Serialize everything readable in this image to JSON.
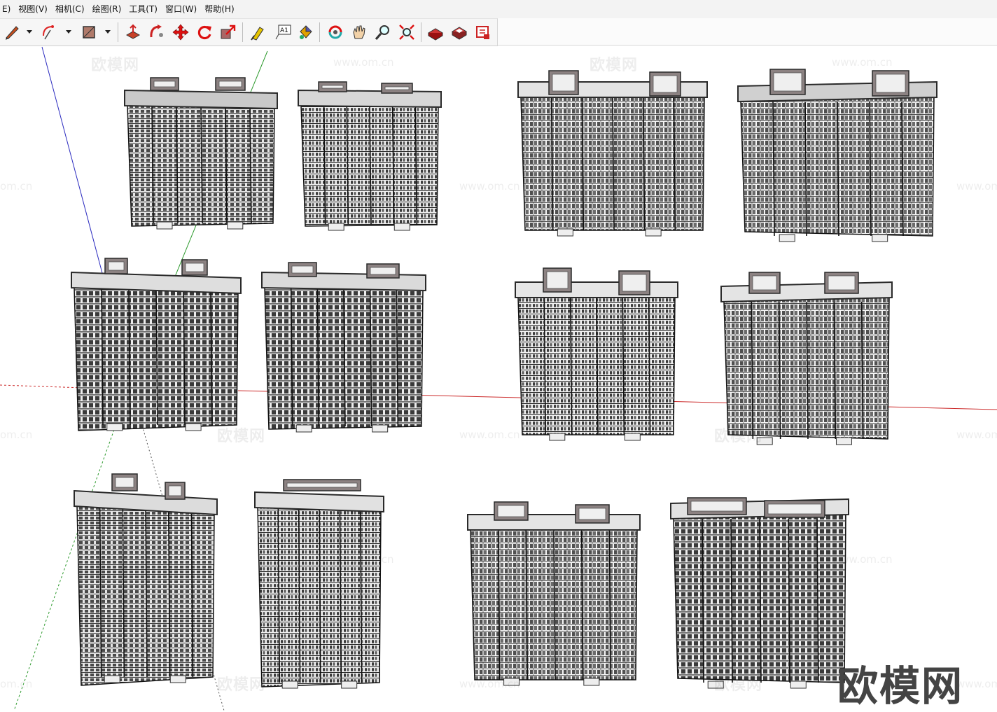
{
  "menu": {
    "items": [
      {
        "name": "menu-edit",
        "label": "E)"
      },
      {
        "name": "menu-view",
        "label": "视图(V)"
      },
      {
        "name": "menu-camera",
        "label": "相机(C)"
      },
      {
        "name": "menu-draw",
        "label": "绘图(R)"
      },
      {
        "name": "menu-tools",
        "label": "工具(T)"
      },
      {
        "name": "menu-window",
        "label": "窗口(W)"
      },
      {
        "name": "menu-help",
        "label": "帮助(H)"
      }
    ]
  },
  "toolbar": {
    "icons": [
      "pencil-icon",
      "arc-icon",
      "rectangle-icon",
      "push-pull-icon",
      "follow-me-icon",
      "move-icon",
      "rotate-icon",
      "scale-icon",
      "tape-measure-icon",
      "text-icon",
      "paint-bucket-icon",
      "orbit-icon",
      "pan-icon",
      "zoom-icon",
      "zoom-extents-icon",
      "warehouse-icon",
      "components-icon",
      "share-model-icon"
    ],
    "text_tool_label": "A1"
  },
  "viewport": {
    "watermark_cn": "欧模网",
    "watermark_url": "www.om.cn",
    "watermark_url_partial": "om.cn",
    "logo_text": "欧模网",
    "axis_colors": {
      "red": "#cc2b2b",
      "green": "#2d9a2d",
      "blue": "#2b2bbf"
    }
  }
}
